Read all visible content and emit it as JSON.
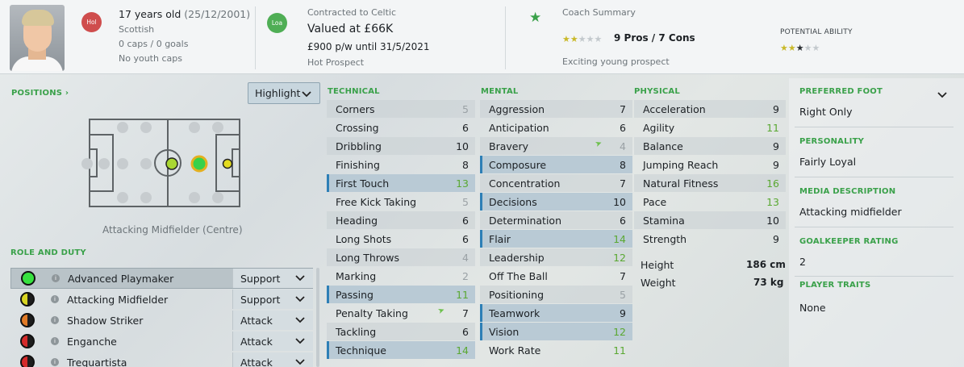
{
  "header": {
    "age": "17 years old",
    "dob": "(25/12/2001)",
    "nationality": "Scottish",
    "caps": "0 caps / 0 goals",
    "youth_caps": "No youth caps",
    "nat_badge": "Hol",
    "contract_badge": "Loa",
    "contract": "Contracted to Celtic",
    "value": "Valued at £66K",
    "wage": "£900 p/w until 31/5/2021",
    "status": "Hot Prospect",
    "coach_title": "Coach Summary",
    "coach_stars": "9 Pros / 7 Cons",
    "coach_note": "Exciting young prospect",
    "potential_label": "POTENTIAL ABILITY",
    "coach_rating": {
      "filled": 1,
      "half": 1,
      "of": 5
    },
    "potential_rating": {
      "filled": 2,
      "dark": 1,
      "of": 5
    }
  },
  "positions": {
    "header": "POSITIONS",
    "highlight_button": "Highlight",
    "position_name": "Attacking Midfielder (Centre)"
  },
  "roles": {
    "header": "ROLE AND DUTY",
    "items": [
      {
        "name": "Advanced Playmaker",
        "duty": "Support"
      },
      {
        "name": "Attacking Midfielder",
        "duty": "Support"
      },
      {
        "name": "Shadow Striker",
        "duty": "Attack"
      },
      {
        "name": "Enganche",
        "duty": "Attack"
      },
      {
        "name": "Trequartista",
        "duty": "Attack"
      }
    ]
  },
  "technical": {
    "header": "TECHNICAL",
    "items": [
      {
        "name": "Corners",
        "value": "5"
      },
      {
        "name": "Crossing",
        "value": "6"
      },
      {
        "name": "Dribbling",
        "value": "10"
      },
      {
        "name": "Finishing",
        "value": "8"
      },
      {
        "name": "First Touch",
        "value": "13"
      },
      {
        "name": "Free Kick Taking",
        "value": "5"
      },
      {
        "name": "Heading",
        "value": "6"
      },
      {
        "name": "Long Shots",
        "value": "6"
      },
      {
        "name": "Long Throws",
        "value": "4"
      },
      {
        "name": "Marking",
        "value": "2"
      },
      {
        "name": "Passing",
        "value": "11"
      },
      {
        "name": "Penalty Taking",
        "value": "7"
      },
      {
        "name": "Tackling",
        "value": "6"
      },
      {
        "name": "Technique",
        "value": "14"
      }
    ]
  },
  "mental": {
    "header": "MENTAL",
    "items": [
      {
        "name": "Aggression",
        "value": "7"
      },
      {
        "name": "Anticipation",
        "value": "6"
      },
      {
        "name": "Bravery",
        "value": "4"
      },
      {
        "name": "Composure",
        "value": "8"
      },
      {
        "name": "Concentration",
        "value": "7"
      },
      {
        "name": "Decisions",
        "value": "10"
      },
      {
        "name": "Determination",
        "value": "6"
      },
      {
        "name": "Flair",
        "value": "14"
      },
      {
        "name": "Leadership",
        "value": "12"
      },
      {
        "name": "Off The Ball",
        "value": "7"
      },
      {
        "name": "Positioning",
        "value": "5"
      },
      {
        "name": "Teamwork",
        "value": "9"
      },
      {
        "name": "Vision",
        "value": "12"
      },
      {
        "name": "Work Rate",
        "value": "11"
      }
    ]
  },
  "physical": {
    "header": "PHYSICAL",
    "items": [
      {
        "name": "Acceleration",
        "value": "9"
      },
      {
        "name": "Agility",
        "value": "11"
      },
      {
        "name": "Balance",
        "value": "9"
      },
      {
        "name": "Jumping Reach",
        "value": "9"
      },
      {
        "name": "Natural Fitness",
        "value": "16"
      },
      {
        "name": "Pace",
        "value": "13"
      },
      {
        "name": "Stamina",
        "value": "10"
      },
      {
        "name": "Strength",
        "value": "9"
      }
    ],
    "height_label": "Height",
    "height": "186 cm",
    "weight_label": "Weight",
    "weight": "73 kg"
  },
  "info": {
    "foot_label": "PREFERRED FOOT",
    "foot": "Right Only",
    "personality_label": "PERSONALITY",
    "personality": "Fairly Loyal",
    "media_label": "MEDIA DESCRIPTION",
    "media": "Attacking midfielder",
    "gk_label": "GOALKEEPER RATING",
    "gk": "2",
    "traits_label": "PLAYER TRAITS",
    "traits": "None"
  },
  "colors": {
    "accent_green": "#3aa14a",
    "highlight_row": "#b9cad5",
    "highlight_border": "#2d7fb6",
    "value_green": "#5aa832"
  }
}
